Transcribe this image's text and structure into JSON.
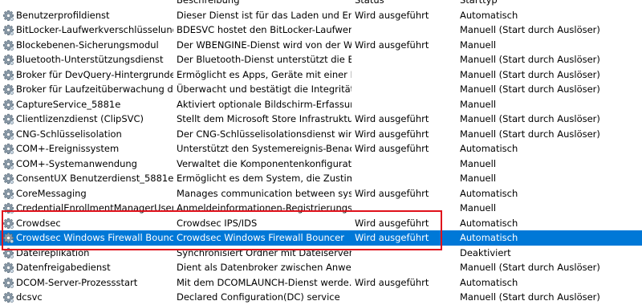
{
  "columns": {
    "name": "",
    "description": "Beschreibung",
    "status": "Status",
    "startup": "Starttyp"
  },
  "selected_index": 15,
  "highlighted_rows": [
    14,
    15
  ],
  "accent_color": "#0078d7",
  "highlight_color": "#e0111b",
  "rows": [
    {
      "name": "Benutzerprofildienst",
      "description": "Dieser Dienst ist für das Laden und Entla...",
      "status": "Wird ausgeführt",
      "startup": "Automatisch"
    },
    {
      "name": "BitLocker-Laufwerkverschlüsselungs...",
      "description": "BDESVC hostet den BitLocker-Laufwerk...",
      "status": "",
      "startup": "Manuell (Start durch Auslöser)"
    },
    {
      "name": "Blockebenen-Sicherungsmodul",
      "description": "Der WBENGINE-Dienst wird von der Wi...",
      "status": "Wird ausgeführt",
      "startup": "Manuell"
    },
    {
      "name": "Bluetooth-Unterstützungsdienst",
      "description": "Der Bluetooth-Dienst unterstützt die Er...",
      "status": "",
      "startup": "Manuell (Start durch Auslöser)"
    },
    {
      "name": "Broker für DevQuery-Hintergrunder...",
      "description": "Ermöglicht es Apps, Geräte mit einer Hi...",
      "status": "",
      "startup": "Manuell (Start durch Auslöser)"
    },
    {
      "name": "Broker für Laufzeitüberwachung der...",
      "description": "Überwacht und bestätigt die Integrität d...",
      "status": "",
      "startup": "Manuell (Start durch Auslöser)"
    },
    {
      "name": "CaptureService_5881e",
      "description": "Aktiviert optionale Bildschirm-Erfassun...",
      "status": "",
      "startup": "Manuell"
    },
    {
      "name": "Clientlizenzdienst (ClipSVC)",
      "description": "Stellt dem Microsoft Store Infrastruktur...",
      "status": "Wird ausgeführt",
      "startup": "Manuell (Start durch Auslöser)"
    },
    {
      "name": "CNG-Schlüsselisolation",
      "description": "Der CNG-Schlüsselisolationsdienst wird ...",
      "status": "Wird ausgeführt",
      "startup": "Manuell (Start durch Auslöser)"
    },
    {
      "name": "COM+-Ereignissystem",
      "description": "Unterstützt den Systemereignis-Benach...",
      "status": "Wird ausgeführt",
      "startup": "Automatisch"
    },
    {
      "name": "COM+-Systemanwendung",
      "description": "Verwaltet die Komponentenkonfigurati...",
      "status": "",
      "startup": "Manuell"
    },
    {
      "name": "ConsentUX Benutzerdienst_5881e",
      "description": "Ermöglicht es dem System, die Zustim...",
      "status": "",
      "startup": "Manuell"
    },
    {
      "name": "CoreMessaging",
      "description": "Manages communication between syst...",
      "status": "Wird ausgeführt",
      "startup": "Automatisch"
    },
    {
      "name": "CredentialEnrollmentManagerUserS...",
      "description": "Anmeldeinformationen-Registrierungs-...",
      "status": "",
      "startup": "Manuell"
    },
    {
      "name": "Crowdsec",
      "description": "Crowdsec IPS/IDS",
      "status": "Wird ausgeführt",
      "startup": "Automatisch"
    },
    {
      "name": "Crowdsec Windows Firewall Bouncer",
      "description": "Crowdsec Windows Firewall Bouncer",
      "status": "Wird ausgeführt",
      "startup": "Automatisch"
    },
    {
      "name": "Dateireplikation",
      "description": "Synchronisiert Ordner mit Dateiservern...",
      "status": "",
      "startup": "Deaktiviert"
    },
    {
      "name": "Datenfreigabedienst",
      "description": "Dient als Datenbroker zwischen Anwen...",
      "status": "",
      "startup": "Manuell (Start durch Auslöser)"
    },
    {
      "name": "DCOM-Server-Prozessstart",
      "description": "Mit dem DCOMLAUNCH-Dienst werde...",
      "status": "Wird ausgeführt",
      "startup": "Automatisch"
    },
    {
      "name": "dcsvc",
      "description": "Declared Configuration(DC) service",
      "status": "",
      "startup": "Manuell (Start durch Auslöser)"
    }
  ]
}
